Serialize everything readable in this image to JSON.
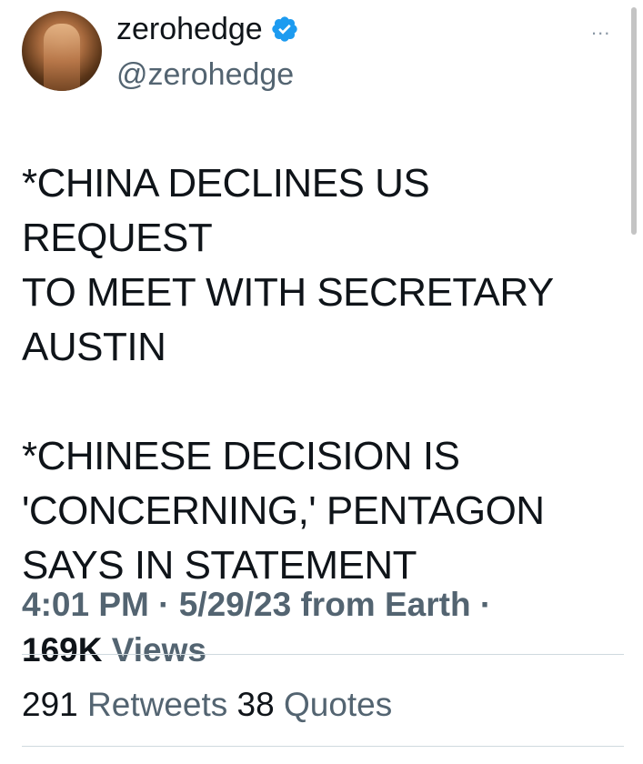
{
  "tweet": {
    "author": {
      "display_name": "zerohedge",
      "handle": "@zerohedge",
      "verified_badge": "verified-badge-icon",
      "badge_color": "#1d9bf0"
    },
    "more_menu": "...",
    "paragraphs": [
      [
        "*CHINA DECLINES US REQUEST",
        "TO MEET WITH SECRETARY",
        "AUSTIN"
      ],
      [
        "*CHINESE DECISION IS",
        "'CONCERNING,' PENTAGON",
        "SAYS IN STATEMENT"
      ]
    ],
    "meta": {
      "time": "4:01 PM",
      "separator": " · ",
      "date": "5/29/23",
      "source": "from Earth",
      "trailing_separator": " ·",
      "views_count": "169K",
      "views_label": "Views"
    },
    "stats": {
      "retweets_count": "291",
      "retweets_label": "Retweets",
      "quotes_count": "38",
      "quotes_label": "Quotes"
    }
  },
  "colors": {
    "text_primary": "#0f1419",
    "text_secondary": "#536471",
    "divider": "#cfd9de"
  }
}
